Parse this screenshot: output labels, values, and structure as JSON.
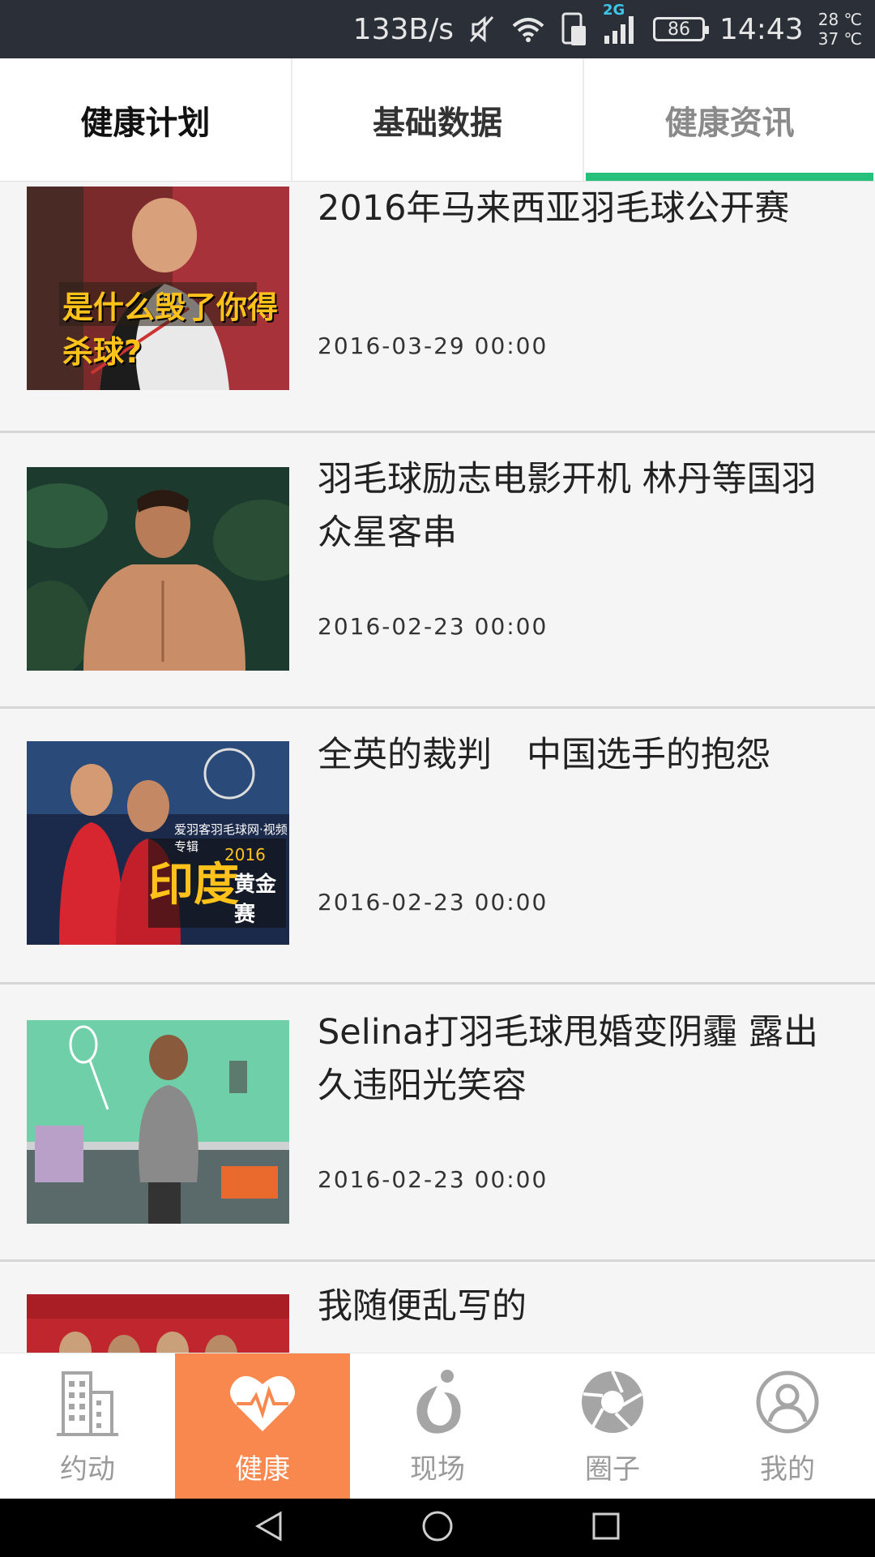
{
  "status_bar": {
    "speed": "133B/s",
    "network_type": "2G",
    "battery": "86",
    "time": "14:43",
    "temp_high": "28 ℃",
    "temp_low": "37 ℃"
  },
  "top_tabs": [
    {
      "label": "健康计划",
      "active": false
    },
    {
      "label": "基础数据",
      "active": false
    },
    {
      "label": "健康资讯",
      "active": true
    }
  ],
  "news": [
    {
      "title": "2016年马来西亚羽毛球公开赛",
      "date": "2016-03-29 00:00",
      "thumb_caption": "是什么毁了你得杀球?"
    },
    {
      "title": "羽毛球励志电影开机 林丹等国羽众星客串",
      "date": "2016-02-23 00:00"
    },
    {
      "title": "全英的裁判　中国选手的抱怨",
      "date": "2016-02-23 00:00",
      "thumb_caption": "印度",
      "thumb_caption2": "黄金赛",
      "thumb_year": "2016",
      "thumb_source": "爱羽客羽毛球网·视频专辑"
    },
    {
      "title": "Selina打羽毛球甩婚变阴霾 露出久违阳光笑容",
      "date": "2016-02-23 00:00"
    },
    {
      "title": "我随便乱写的",
      "date": ""
    }
  ],
  "bottom_nav": [
    {
      "label": "约动",
      "icon": "building-icon",
      "active": false
    },
    {
      "label": "健康",
      "icon": "heart-pulse-icon",
      "active": true
    },
    {
      "label": "现场",
      "icon": "runner-icon",
      "active": false
    },
    {
      "label": "圈子",
      "icon": "aperture-icon",
      "active": false
    },
    {
      "label": "我的",
      "icon": "user-icon",
      "active": false
    }
  ],
  "colors": {
    "accent_green": "#27c07a",
    "nav_active": "#f9884e",
    "status_bar": "#2b2f38"
  }
}
